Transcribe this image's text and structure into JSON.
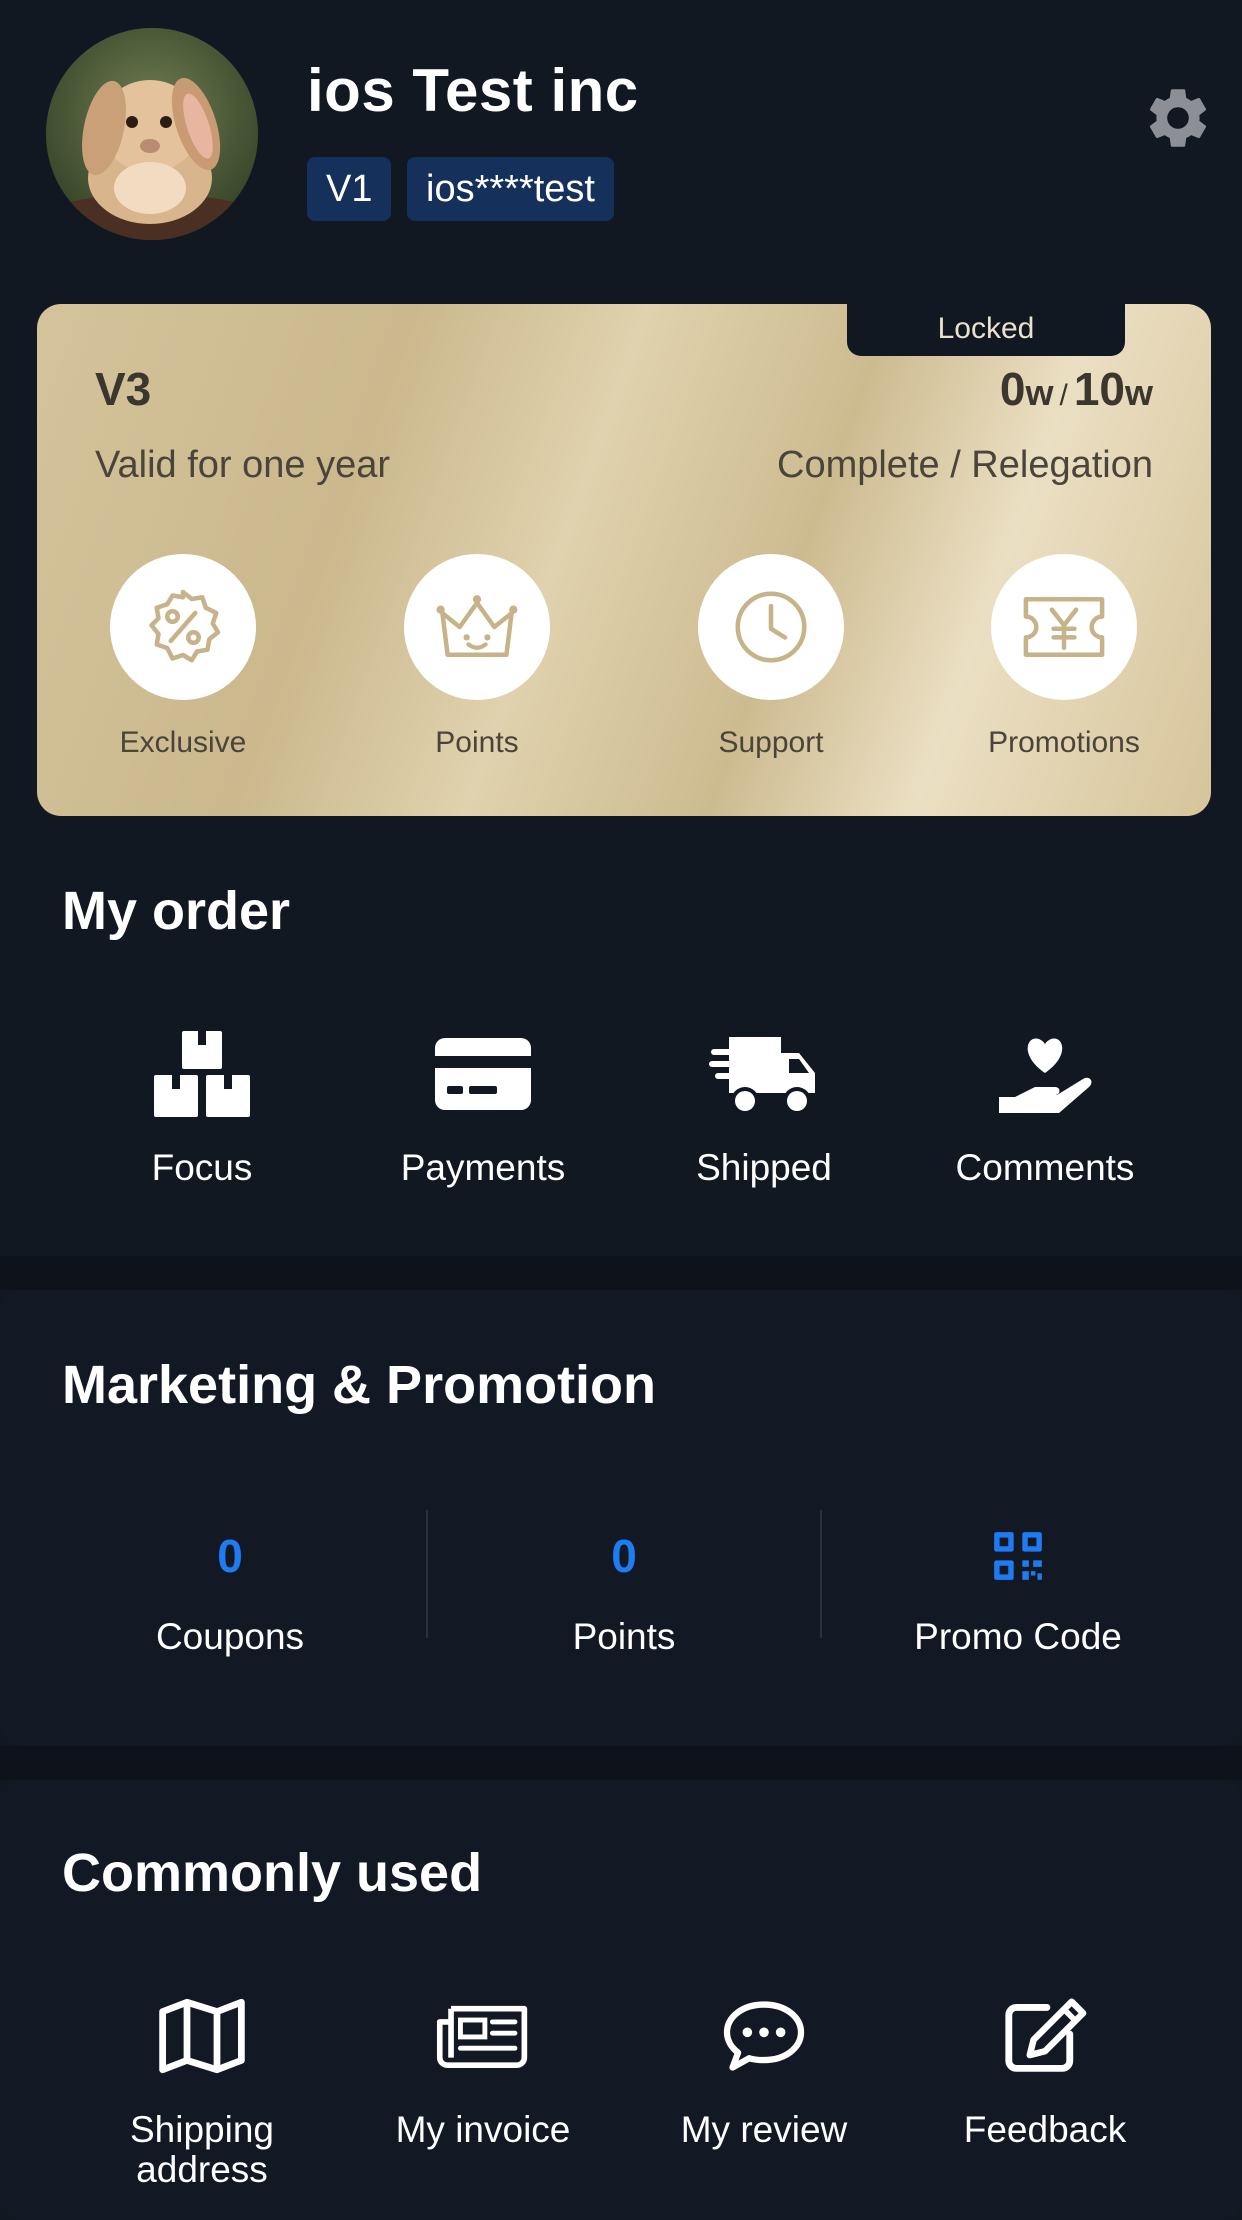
{
  "profile": {
    "name": "ios Test inc",
    "level_badge": "V1",
    "account_badge": "ios****test"
  },
  "vip_card": {
    "locked_label": "Locked",
    "level": "V3",
    "progress_current": "0",
    "progress_target": "10",
    "progress_unit": "w",
    "validity": "Valid for one year",
    "status": "Complete / Relegation",
    "benefits": [
      {
        "label": "Exclusive",
        "icon": "discount-badge-icon"
      },
      {
        "label": "Points",
        "icon": "crown-icon"
      },
      {
        "label": "Support",
        "icon": "clock-icon"
      },
      {
        "label": "Promotions",
        "icon": "yuan-ticket-icon"
      }
    ]
  },
  "orders": {
    "title": "My order",
    "items": [
      {
        "label": "Focus",
        "icon": "boxes-icon"
      },
      {
        "label": "Payments",
        "icon": "credit-card-icon"
      },
      {
        "label": "Shipped",
        "icon": "truck-icon"
      },
      {
        "label": "Comments",
        "icon": "hand-heart-icon"
      }
    ]
  },
  "marketing": {
    "title": "Marketing & Promotion",
    "coupons_value": "0",
    "coupons_label": "Coupons",
    "points_value": "0",
    "points_label": "Points",
    "promo_label": "Promo Code"
  },
  "common": {
    "title": "Commonly used",
    "items": [
      {
        "label": "Shipping address",
        "icon": "map-icon"
      },
      {
        "label": "My invoice",
        "icon": "newspaper-icon"
      },
      {
        "label": "My review",
        "icon": "chat-bubble-icon"
      },
      {
        "label": "Feedback",
        "icon": "edit-icon"
      }
    ]
  },
  "colors": {
    "background": "#121822",
    "accent_blue": "#1d7cf2",
    "badge_bg": "#15305a",
    "gold_card": "#d4c39b"
  }
}
